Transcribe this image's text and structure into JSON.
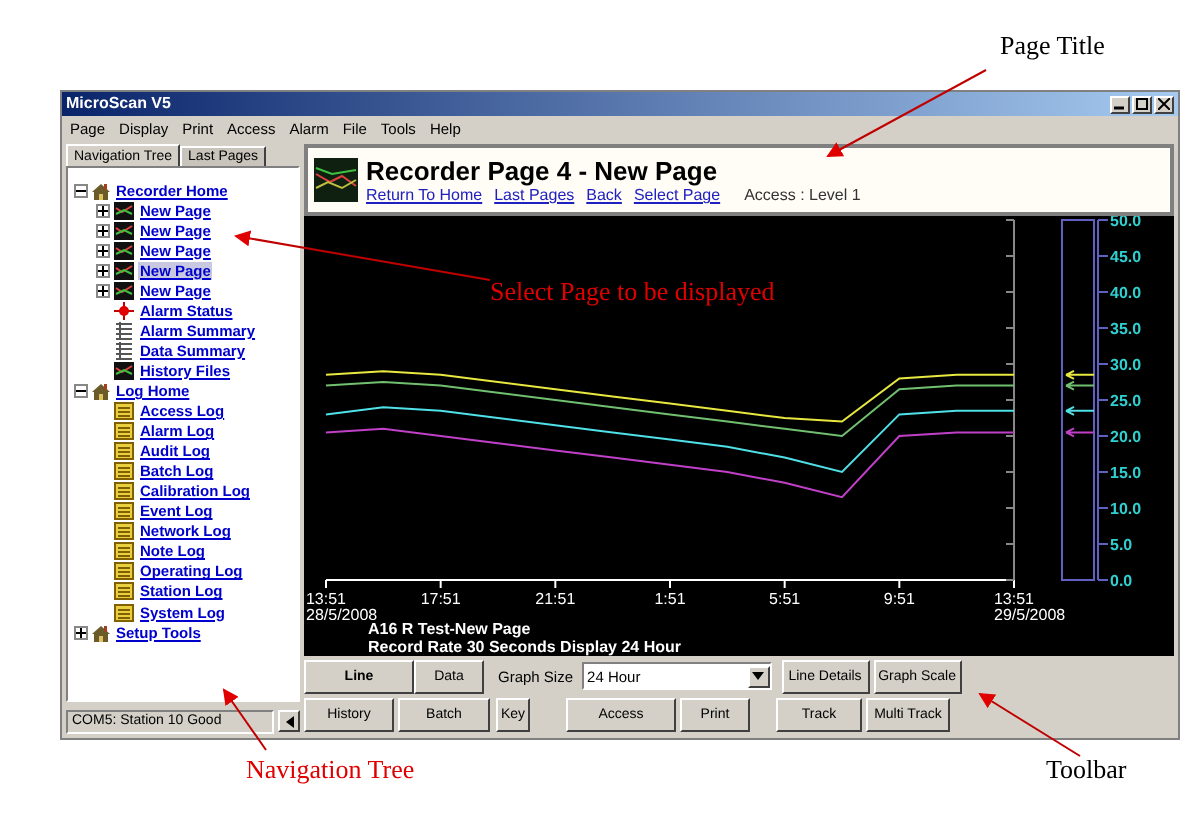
{
  "window": {
    "title": "MicroScan V5"
  },
  "menu": [
    "Page",
    "Display",
    "Print",
    "Access",
    "Alarm",
    "File",
    "Tools",
    "Help"
  ],
  "left_tabs": [
    {
      "label": "Navigation Tree",
      "selected": true
    },
    {
      "label": "Last Pages",
      "selected": false
    }
  ],
  "tree": [
    {
      "label": "Recorder Home",
      "kind": "home",
      "expanded": true,
      "selected": false,
      "children": [
        {
          "label": "New Page",
          "kind": "recorder",
          "expanded": false,
          "selected": false
        },
        {
          "label": "New Page",
          "kind": "recorder",
          "expanded": false,
          "selected": false
        },
        {
          "label": "New Page",
          "kind": "recorder",
          "expanded": false,
          "selected": false
        },
        {
          "label": "New Page",
          "kind": "recorder",
          "expanded": false,
          "selected": true
        },
        {
          "label": "New Page",
          "kind": "recorder",
          "expanded": false,
          "selected": false
        },
        {
          "label": "Alarm Status",
          "kind": "alarm",
          "selected": false
        },
        {
          "label": "Alarm Summary",
          "kind": "summary",
          "selected": false
        },
        {
          "label": "Data Summary",
          "kind": "summary",
          "selected": false
        },
        {
          "label": "History Files",
          "kind": "recorder",
          "selected": false
        }
      ]
    },
    {
      "label": "Log Home",
      "kind": "home",
      "expanded": true,
      "selected": false,
      "children": [
        {
          "label": "Access Log",
          "kind": "log",
          "selected": false
        },
        {
          "label": "Alarm Log",
          "kind": "log",
          "selected": false
        },
        {
          "label": "Audit Log",
          "kind": "log",
          "selected": false
        },
        {
          "label": "Batch Log",
          "kind": "log",
          "selected": false
        },
        {
          "label": "Calibration Log",
          "kind": "log",
          "selected": false
        },
        {
          "label": "Event Log",
          "kind": "log",
          "selected": false
        },
        {
          "label": "Network Log",
          "kind": "log",
          "selected": false
        },
        {
          "label": "Note Log",
          "kind": "log",
          "selected": false
        },
        {
          "label": "Operating Log",
          "kind": "log",
          "selected": false
        },
        {
          "label": "Station Log",
          "kind": "log",
          "selected": false
        },
        {
          "label": "System Log",
          "kind": "log",
          "selected": false
        }
      ]
    },
    {
      "label": "Setup Tools",
      "kind": "home",
      "expanded": false,
      "selected": false
    }
  ],
  "status_bar": {
    "text": "COM5: Station 10 Good"
  },
  "page_header": {
    "title": "Recorder Page 4 - New Page",
    "links": [
      "Return To Home",
      "Last Pages",
      "Back",
      "Select Page"
    ],
    "access": "Access : Level 1"
  },
  "chart": {
    "start_date": "28/5/2008",
    "end_date": "29/5/2008",
    "info": [
      "A16 R Test-New Page",
      "Record Rate 30 Seconds Display 24 Hour"
    ],
    "chart_data": {
      "type": "line",
      "categories": [
        "13:51",
        null,
        "17:51",
        null,
        "21:51",
        null,
        "1:51",
        null,
        "5:51",
        null,
        "9:51",
        null,
        "13:51"
      ],
      "ylim": [
        0,
        50
      ],
      "yticks": [
        {
          "value": 0,
          "label": "0.0"
        },
        {
          "value": 5,
          "label": "5.0"
        },
        {
          "value": 10,
          "label": "10.0"
        },
        {
          "value": 15,
          "label": "15.0"
        },
        {
          "value": 20,
          "label": "20.0"
        },
        {
          "value": 25,
          "label": "25.0"
        },
        {
          "value": 30,
          "label": "30.0"
        },
        {
          "value": 35,
          "label": "35.0"
        },
        {
          "value": 40,
          "label": "40.0"
        },
        {
          "value": 45,
          "label": "45.0"
        },
        {
          "value": 50,
          "label": "50.0"
        }
      ],
      "series": [
        {
          "color": "#e8e840",
          "values": [
            28.5,
            29,
            28.5,
            27.5,
            26.5,
            25.5,
            24.5,
            23.5,
            22.5,
            22,
            28,
            28.5,
            28.5
          ]
        },
        {
          "color": "#70c070",
          "values": [
            27,
            27.5,
            27,
            26,
            25,
            24,
            23,
            22,
            21,
            20,
            26.5,
            27,
            27
          ]
        },
        {
          "color": "#50e0e8",
          "values": [
            23,
            24,
            23.5,
            22.5,
            21.5,
            20.5,
            19.5,
            18.5,
            17,
            15,
            23,
            23.5,
            23.5
          ]
        },
        {
          "color": "#c040c8",
          "values": [
            20.5,
            21,
            20,
            19,
            18,
            17,
            16,
            15,
            13.5,
            11.5,
            20,
            20.5,
            20.5
          ]
        }
      ]
    }
  },
  "toolbar": {
    "upper_row": [
      {
        "kind": "button",
        "label": "Line",
        "selected": true
      },
      {
        "kind": "button",
        "label": "Data",
        "selected": false
      },
      {
        "kind": "label",
        "label": "Graph Size"
      },
      {
        "kind": "select",
        "value": "24 Hour"
      },
      {
        "kind": "button",
        "label": "Line Details",
        "selected": false
      },
      {
        "kind": "button",
        "label": "Graph Scale",
        "selected": false
      }
    ],
    "lower_row": [
      {
        "kind": "button",
        "label": "History",
        "selected": false
      },
      {
        "kind": "button",
        "label": "Batch",
        "selected": false
      },
      {
        "kind": "button",
        "label": "Key",
        "selected": false
      },
      {
        "kind": "button",
        "label": "Access",
        "selected": false
      },
      {
        "kind": "button",
        "label": "Print",
        "selected": false
      },
      {
        "kind": "button",
        "label": "Track",
        "selected": false
      },
      {
        "kind": "button",
        "label": "Multi Track",
        "selected": false
      }
    ]
  },
  "annotations": [
    {
      "text": "Page Title",
      "color": "#000000"
    },
    {
      "text": "Select Page to be displayed",
      "color": "#e00000"
    },
    {
      "text": "Navigation Tree",
      "color": "#e00000"
    },
    {
      "text": "Toolbar",
      "color": "#000000"
    }
  ]
}
